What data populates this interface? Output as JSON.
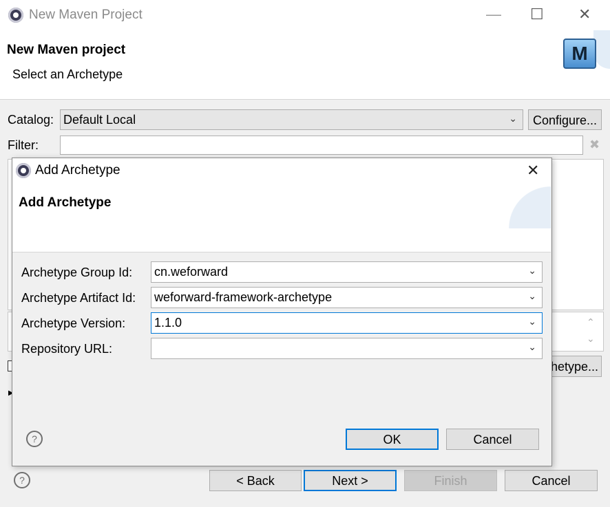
{
  "window": {
    "title": "New Maven Project",
    "icon": "eclipse-gear-icon",
    "header_title": "New Maven project",
    "header_subtitle": "Select an Archetype",
    "logo_text": "M",
    "catalog_label": "Catalog:",
    "catalog_value": "Default Local",
    "configure_label": "Configure...",
    "filter_label": "Filter:",
    "filter_value": "",
    "add_archetype_partial_label": "hetype...",
    "buttons": {
      "back": "< Back",
      "next": "Next >",
      "finish": "Finish",
      "cancel": "Cancel"
    },
    "controls": {
      "minimize": "—",
      "maximize": "☐",
      "close": "✕"
    }
  },
  "dialog": {
    "title": "Add Archetype",
    "icon": "eclipse-gear-icon",
    "header_title": "Add Archetype",
    "fields": [
      {
        "label": "Archetype Group Id:",
        "value": "cn.weforward"
      },
      {
        "label": "Archetype Artifact Id:",
        "value": "weforward-framework-archetype"
      },
      {
        "label": "Archetype Version:",
        "value": "1.1.0"
      },
      {
        "label": "Repository URL:",
        "value": ""
      }
    ],
    "ok_label": "OK",
    "cancel_label": "Cancel",
    "close": "✕"
  },
  "colors": {
    "focus": "#0078d7",
    "window_bg": "#f0f0f0",
    "header_bg": "#ffffff"
  }
}
